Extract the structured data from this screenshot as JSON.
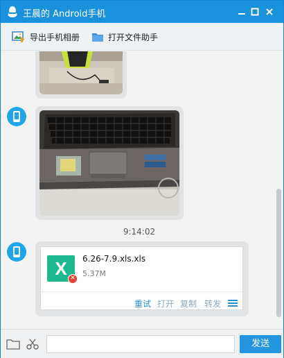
{
  "window": {
    "title": "王晨的 Android手机"
  },
  "toolbar": {
    "export_album_label": "导出手机相册",
    "open_file_assistant_label": "打开文件助手"
  },
  "chat": {
    "timestamp": "9:14:02",
    "file": {
      "name": "6.26-7.9.xls.xls",
      "size": "5.37M",
      "icon_letter": "X",
      "actions": [
        "重试",
        "打开",
        "复制",
        "转发"
      ]
    }
  },
  "bottombar": {
    "send_label": "发送"
  },
  "colors": {
    "accent": "#1a91dc",
    "excel_green": "#1eb98f",
    "error_red": "#e04433",
    "action_blue": "#2a8fd6",
    "action_gray": "#8aa6c0"
  }
}
